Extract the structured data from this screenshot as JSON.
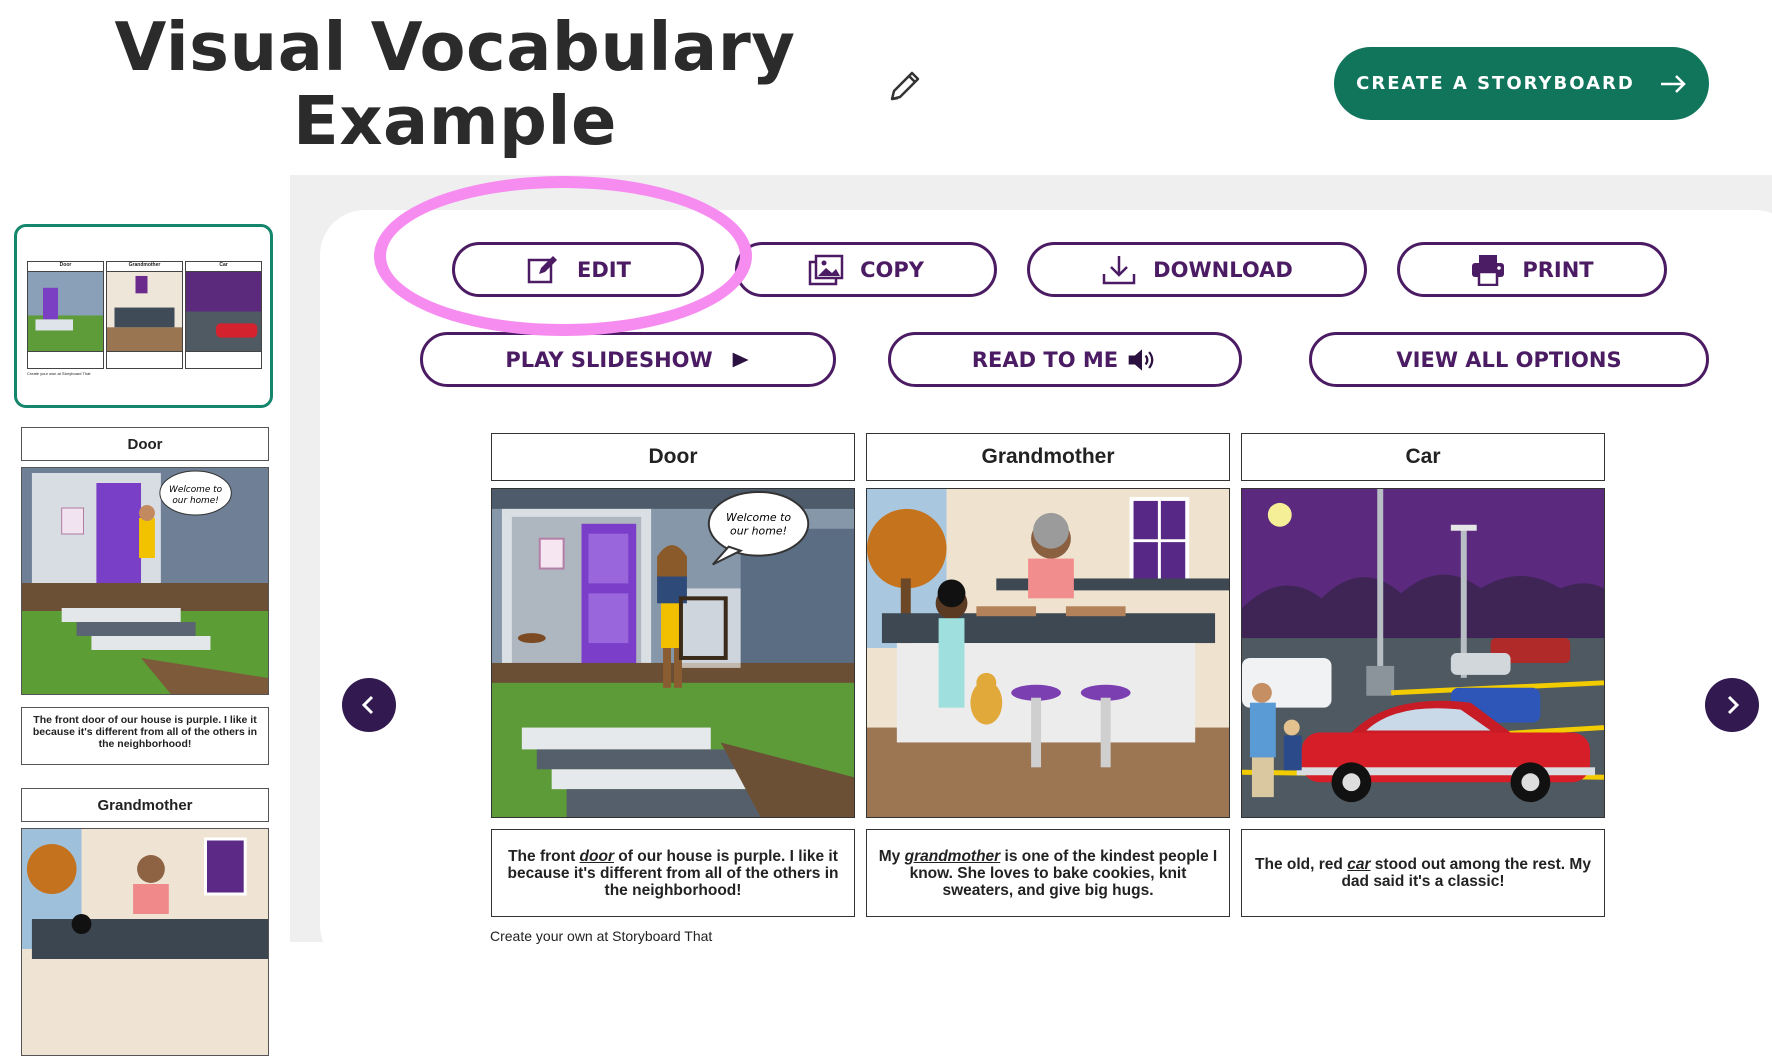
{
  "header": {
    "title": "Visual Vocabulary Example",
    "create_button": "CREATE A STORYBOARD"
  },
  "actions": {
    "edit": "EDIT",
    "copy": "COPY",
    "download": "DOWNLOAD",
    "print": "PRINT",
    "play_slideshow": "PLAY SLIDESHOW",
    "read_to_me": "READ TO ME",
    "view_all_options": "VIEW ALL OPTIONS"
  },
  "storyboard": {
    "cells": [
      {
        "title": "Door",
        "text_before": "The front ",
        "keyword": "door",
        "text_after": " of our house is purple. I like it because it's different from all of the others in the neighborhood!",
        "bubble": "Welcome to our home!"
      },
      {
        "title": "Grandmother",
        "text_before": "My ",
        "keyword": "grandmother",
        "text_after": " is one of the kindest people I know. She loves to bake cookies, knit sweaters, and give big hugs."
      },
      {
        "title": "Car",
        "text_before": "The old, red ",
        "keyword": "car",
        "text_after": " stood out among the rest. My dad said it's a classic!"
      }
    ],
    "footer": "Create your own at Storyboard That"
  },
  "sidebar": {
    "mini_footer": "Create your own at Storyboard That",
    "panels": [
      {
        "title": "Door",
        "text": "The front door of our house is purple. I like it because it's different from all of the others in the neighborhood!"
      },
      {
        "title": "Grandmother"
      }
    ]
  },
  "icons": {
    "title_edit": "pencil-icon",
    "edit": "edit-square-icon",
    "copy": "image-copy-icon",
    "download": "download-icon",
    "print": "printer-icon",
    "play": "play-triangle-icon",
    "read": "speaker-icon",
    "nav_prev": "chevron-left-icon",
    "nav_next": "chevron-right-icon"
  },
  "colors": {
    "brand_green": "#11755c",
    "brand_purple": "#4b1b63",
    "highlight_pink": "#f78cf0",
    "nav_dark": "#32194f"
  }
}
